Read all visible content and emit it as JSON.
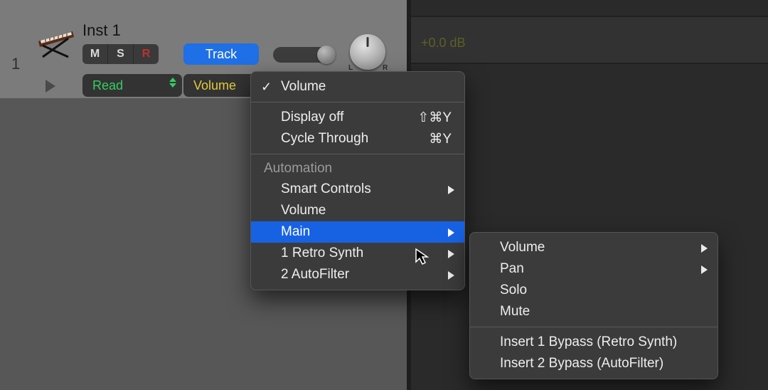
{
  "track": {
    "number": "1",
    "name": "Inst 1",
    "mute_label": "M",
    "solo_label": "S",
    "rec_label": "R",
    "track_button": "Track",
    "pan_l": "L",
    "pan_r": "R"
  },
  "automation": {
    "mode_label": "Read",
    "param_label": "Volume"
  },
  "timeline": {
    "db_label": "+0.0 dB"
  },
  "menu_primary": {
    "volume": "Volume",
    "display_off": "Display off",
    "display_off_shortcut": "⇧⌘Y",
    "cycle_through": "Cycle Through",
    "cycle_through_shortcut": "⌘Y",
    "automation_header": "Automation",
    "smart_controls": "Smart Controls",
    "volume2": "Volume",
    "main": "Main",
    "retro_synth": "1 Retro Synth",
    "autofilter": "2 AutoFilter"
  },
  "menu_sub": {
    "volume": "Volume",
    "pan": "Pan",
    "solo": "Solo",
    "mute": "Mute",
    "insert1": "Insert 1 Bypass (Retro Synth)",
    "insert2": "Insert 2 Bypass (AutoFilter)"
  }
}
